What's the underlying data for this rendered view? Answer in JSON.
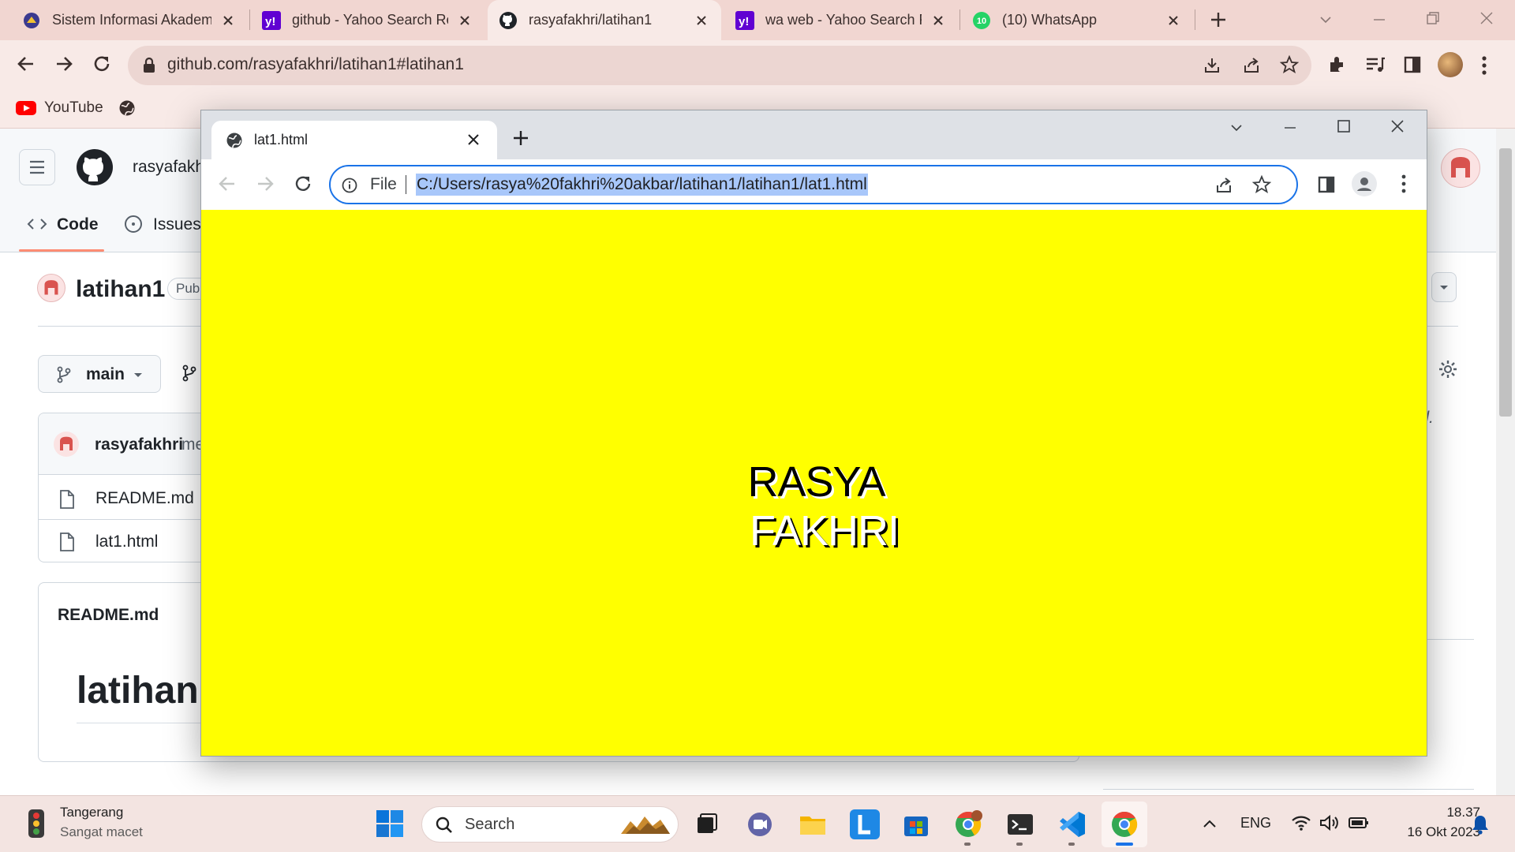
{
  "browser": {
    "tabs": [
      {
        "label": "Sistem Informasi Akadem",
        "icon": "university-icon"
      },
      {
        "label": "github - Yahoo Search Re",
        "icon": "yahoo-icon"
      },
      {
        "label": "rasyafakhri/latihan1",
        "icon": "github-icon"
      },
      {
        "label": "wa web - Yahoo Search R",
        "icon": "yahoo-icon"
      },
      {
        "label": "(10) WhatsApp",
        "icon": "whatsapp-icon",
        "badge": "10"
      }
    ],
    "active_tab_index": 2,
    "url": "github.com/rasyafakhri/latihan1#latihan1",
    "bookmarks": [
      {
        "label": "YouTube"
      }
    ]
  },
  "github": {
    "username": "rasyafakh",
    "nav": {
      "code": "Code",
      "issues": "Issues"
    },
    "repo_name": "latihan1",
    "visibility": "Pub",
    "branch": "main",
    "commit_author": "rasyafakhri",
    "commit_msg": "me",
    "files": [
      "README.md",
      "lat1.html"
    ],
    "readme_header": "README.md",
    "readme_title": "latihan1",
    "right_note": "ded."
  },
  "popup": {
    "tab_title": "lat1.html",
    "file_label": "File",
    "url": "C:/Users/rasya%20fakhri%20akbar/latihan1/latihan1/lat1.html",
    "content": {
      "line1": "RASYA",
      "line2": "FAKHRI",
      "background": "#ffff00"
    }
  },
  "taskbar": {
    "weather_city": "Tangerang",
    "weather_status": "Sangat macet",
    "search_placeholder": "Search",
    "lang": "ENG",
    "time": "18.37",
    "date": "16 Okt 2023"
  },
  "colors": {
    "accent": "#1a73e8",
    "yellow": "#ffff00",
    "github_red": "#d9534f"
  }
}
